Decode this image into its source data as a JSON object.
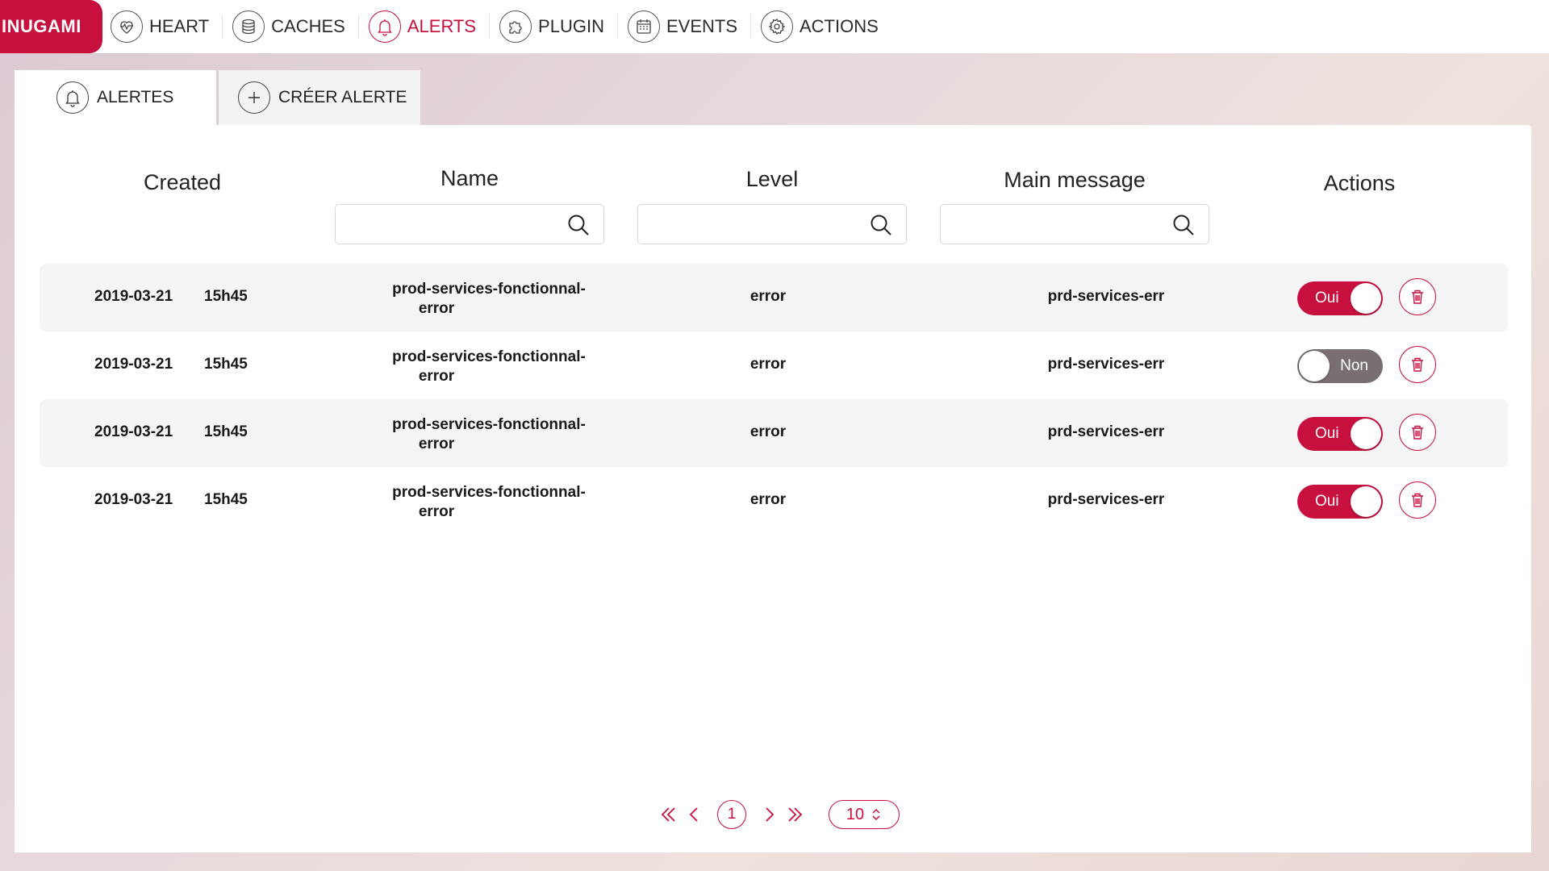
{
  "brand": "INUGAMI",
  "nav": [
    {
      "label": "HEART",
      "icon": "heart-icon",
      "active": false
    },
    {
      "label": "CACHES",
      "icon": "database-icon",
      "active": false
    },
    {
      "label": "ALERTS",
      "icon": "bell-icon",
      "active": true
    },
    {
      "label": "PLUGIN",
      "icon": "puzzle-icon",
      "active": false
    },
    {
      "label": "EVENTS",
      "icon": "calendar-icon",
      "active": false
    },
    {
      "label": "ACTIONS",
      "icon": "gear-icon",
      "active": false
    }
  ],
  "tabs": [
    {
      "label": "ALERTES",
      "icon": "bell-icon",
      "active": true
    },
    {
      "label": "CRÉER ALERTE",
      "icon": "plus-icon",
      "active": false
    }
  ],
  "table": {
    "columns": {
      "created": "Created",
      "name": "Name",
      "level": "Level",
      "main_message": "Main message",
      "actions": "Actions"
    },
    "filters": {
      "name": "",
      "level": "",
      "main_message": ""
    },
    "rows": [
      {
        "date": "2019-03-21",
        "time": "15h45",
        "name_line1": "prod-services-fonctionnal-",
        "name_line2": "error",
        "level": "error",
        "message": "prd-services-err",
        "enabled": true,
        "toggle_label": "Oui"
      },
      {
        "date": "2019-03-21",
        "time": "15h45",
        "name_line1": "prod-services-fonctionnal-",
        "name_line2": "error",
        "level": "error",
        "message": "prd-services-err",
        "enabled": false,
        "toggle_label": "Non"
      },
      {
        "date": "2019-03-21",
        "time": "15h45",
        "name_line1": "prod-services-fonctionnal-",
        "name_line2": "error",
        "level": "error",
        "message": "prd-services-err",
        "enabled": true,
        "toggle_label": "Oui"
      },
      {
        "date": "2019-03-21",
        "time": "15h45",
        "name_line1": "prod-services-fonctionnal-",
        "name_line2": "error",
        "level": "error",
        "message": "prd-services-err",
        "enabled": true,
        "toggle_label": "Oui"
      }
    ]
  },
  "pagination": {
    "current_page": "1",
    "page_size": "10"
  },
  "colors": {
    "accent": "#c8103f",
    "toggle_off": "#7a6f70",
    "row_stripe": "#f5f5f5"
  }
}
